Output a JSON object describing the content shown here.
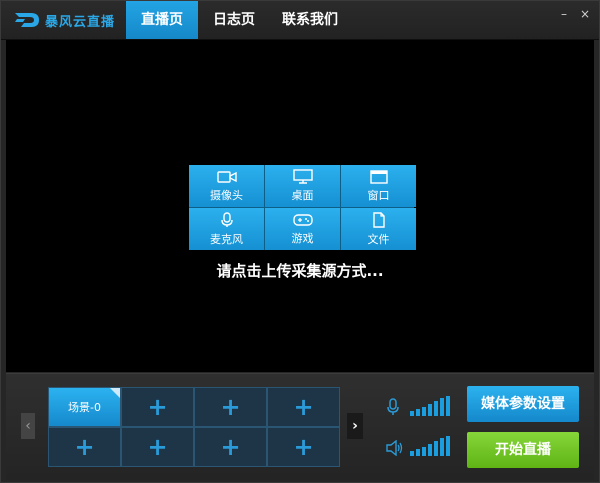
{
  "app": {
    "name": "暴风云直播"
  },
  "tabs": [
    {
      "label": "直播页",
      "active": true
    },
    {
      "label": "日志页",
      "active": false
    },
    {
      "label": "联系我们",
      "active": false
    }
  ],
  "window_controls": {
    "minimize": "–",
    "close": "×"
  },
  "sources": [
    {
      "label": "摄像头",
      "icon": "camera-icon"
    },
    {
      "label": "桌面",
      "icon": "monitor-icon"
    },
    {
      "label": "窗口",
      "icon": "window-icon"
    },
    {
      "label": "麦克风",
      "icon": "microphone-icon"
    },
    {
      "label": "游戏",
      "icon": "gamepad-icon"
    },
    {
      "label": "文件",
      "icon": "file-icon"
    }
  ],
  "prompt": "请点击上传采集源方式...",
  "scenes": [
    {
      "label": "场景-0",
      "active": true
    },
    {
      "label": "+"
    },
    {
      "label": "+"
    },
    {
      "label": "+"
    },
    {
      "label": "+"
    },
    {
      "label": "+"
    },
    {
      "label": "+"
    },
    {
      "label": "+"
    }
  ],
  "nav": {
    "prev": "‹",
    "next": "›"
  },
  "buttons": {
    "settings": "媒体参数设置",
    "start": "开始直播"
  },
  "colors": {
    "accent": "#1a9ee0",
    "start_green": "#6cc21f",
    "background": "#262626",
    "preview": "#000000"
  }
}
